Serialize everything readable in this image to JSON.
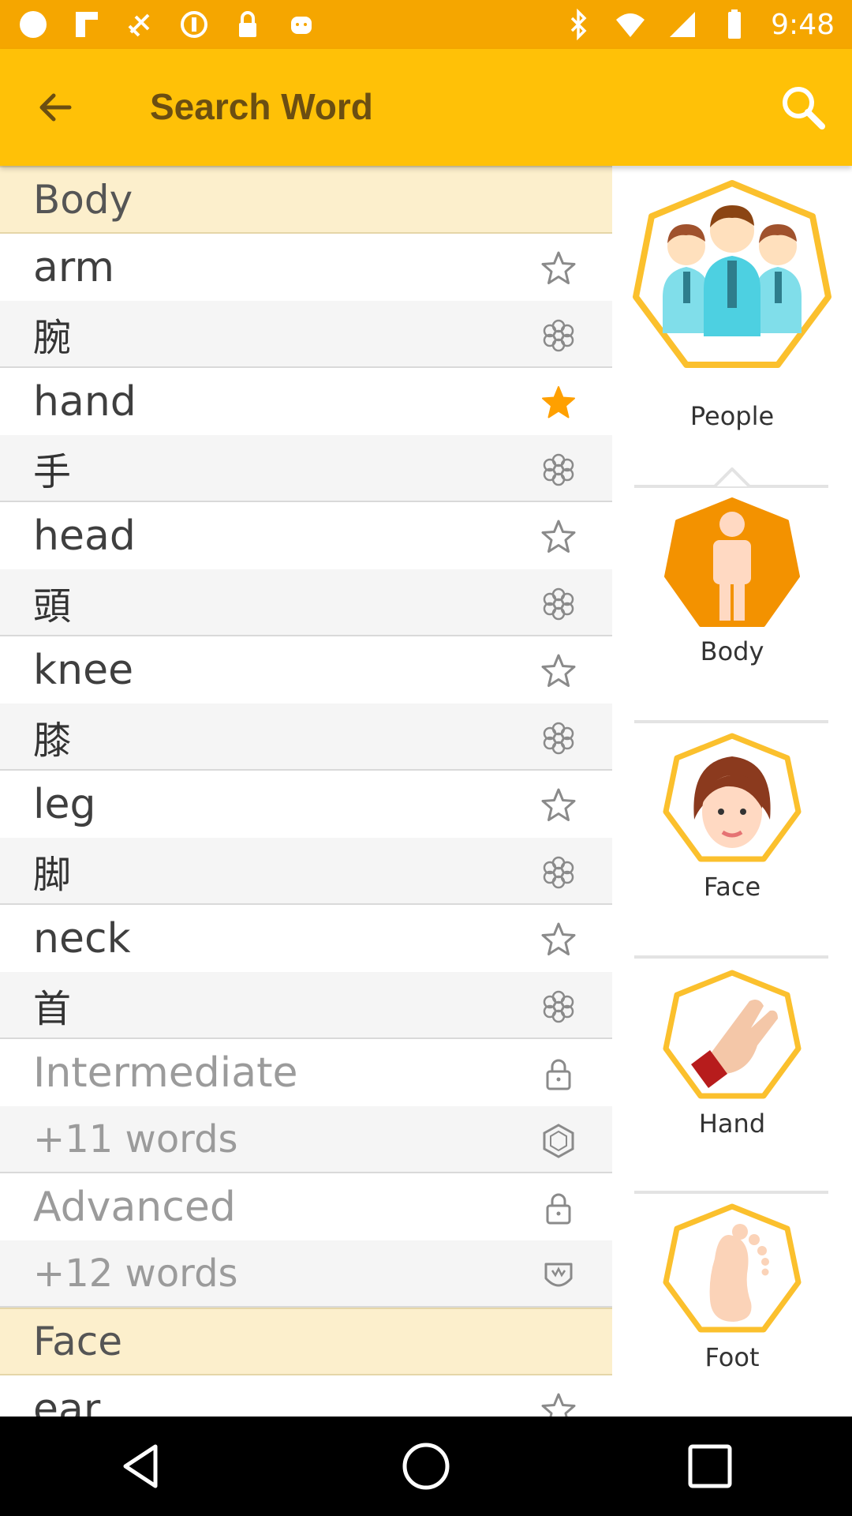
{
  "status_bar": {
    "time": "9:48"
  },
  "app_bar": {
    "title": "Search Word"
  },
  "colors": {
    "accent": "#ffc107",
    "status": "#f5a600",
    "star_active": "#ffa000",
    "section_bg": "#fcefcc"
  },
  "list": {
    "sections": [
      {
        "title": "Body",
        "words": [
          {
            "en": "arm",
            "jp": "腕",
            "favorite": false
          },
          {
            "en": "hand",
            "jp": "手",
            "favorite": true
          },
          {
            "en": "head",
            "jp": "頭",
            "favorite": false
          },
          {
            "en": "knee",
            "jp": "膝",
            "favorite": false
          },
          {
            "en": "leg",
            "jp": "脚",
            "favorite": false
          },
          {
            "en": "neck",
            "jp": "首",
            "favorite": false
          }
        ],
        "locked": [
          {
            "level": "Intermediate",
            "count": "+11 words"
          },
          {
            "level": "Advanced",
            "count": "+12 words"
          }
        ]
      },
      {
        "title": "Face",
        "words": [
          {
            "en": "ear",
            "favorite": false
          }
        ]
      }
    ]
  },
  "categories": [
    {
      "label": "People",
      "icon": "people-icon"
    },
    {
      "label": "Body",
      "icon": "body-icon"
    },
    {
      "label": "Face",
      "icon": "face-icon"
    },
    {
      "label": "Hand",
      "icon": "hand-icon"
    },
    {
      "label": "Foot",
      "icon": "foot-icon"
    }
  ]
}
